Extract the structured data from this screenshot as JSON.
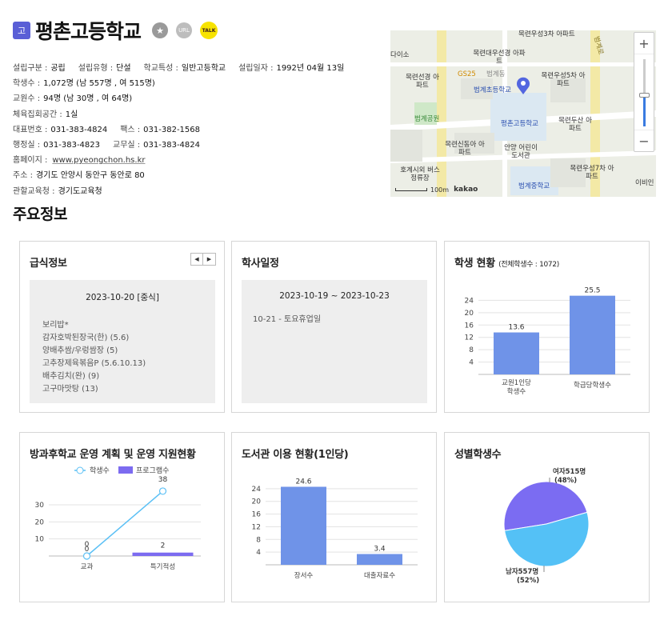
{
  "header": {
    "badge": "고",
    "name": "평촌고등학교",
    "url_label": "URL",
    "talk_label": "TALK"
  },
  "info": {
    "founding_type_label": "설립구분 :",
    "founding_type": "공립",
    "establish_type_label": "설립유형 :",
    "establish_type": "단설",
    "feature_label": "학교특성 :",
    "feature": "일반고등학교",
    "date_label": "설립일자 :",
    "date": "1992년 04월 13일",
    "students_label": "학생수 :",
    "students": "1,072명 (남 557명 , 여 515명)",
    "teachers_label": "교원수 :",
    "teachers": "94명 (남 30명 , 여 64명)",
    "gym_label": "체육집회공간 :",
    "gym": "1실",
    "phone_label": "대표번호 :",
    "phone": "031-383-4824",
    "fax_label": "팩스 :",
    "fax": "031-382-1568",
    "admin_label": "행정실 :",
    "admin": "031-383-4823",
    "staff_label": "교무실 :",
    "staff": "031-383-4824",
    "homepage_label": "홈페이지 :",
    "homepage": "www.pyeongchon.hs.kr",
    "address_label": "주소 :",
    "address": "경기도 안양시 동안구 동안로 80",
    "office_label": "관할교육청 :",
    "office": "경기도교육청"
  },
  "map": {
    "labels": [
      "목련대우선경 아파트",
      "목련선경 아파트",
      "GS25",
      "범계초등학교",
      "목련우성5차 아파트",
      "범계공원",
      "평촌고등학교",
      "목련두산 아파트",
      "목련신동아 아파트",
      "안양 어린이 도서관",
      "목련우성7차 아파트",
      "호계시외 버스정류장",
      "범계중학교",
      "다이소",
      "범계동",
      "이비인",
      "목련우성3차 아파트",
      "범계로"
    ],
    "scale": "100m",
    "brand": "kakao"
  },
  "section_title": "주요정보",
  "meal": {
    "title": "급식정보",
    "prev": "◀",
    "next": "▶",
    "date": "2023-10-20 [중식]",
    "items": [
      "보리밥*",
      "감자호박된장국(한) (5.6)",
      "양배추쌈/우렁쌈장 (5)",
      "고추장제육볶음P (5.6.10.13)",
      "배추김치(완) (9)",
      "고구마맛탕 (13)"
    ]
  },
  "schedule": {
    "title": "학사일정",
    "range": "2023-10-19 ~ 2023-10-23",
    "items": [
      "10-21 - 토요휴업일"
    ]
  },
  "student_status": {
    "title": "학생 현황",
    "subtitle": "(전체학생수 : 1072)"
  },
  "after_school": {
    "title": "방과후학교 운영 계획 및 운영 지원현황"
  },
  "library": {
    "title": "도서관 이용 현황(1인당)"
  },
  "gender": {
    "title": "성별학생수"
  },
  "colors": {
    "bar": "#6f93e8",
    "line": "#5bc0f5",
    "program": "#7c6bf0",
    "female": "#7b6cf2",
    "male": "#54c1f6",
    "badge": "#5a5fd6"
  },
  "chart_data": [
    {
      "type": "bar",
      "categories": [
        "교원1인당 학생수",
        "학급당학생수"
      ],
      "values": [
        13.6,
        25.5
      ],
      "ylim": [
        0,
        28
      ],
      "yticks": [
        4,
        8,
        12,
        16,
        20,
        24
      ]
    },
    {
      "type": "line",
      "categories": [
        "교과",
        "특기적성"
      ],
      "series": [
        {
          "name": "학생수",
          "kind": "line",
          "values": [
            0,
            38
          ]
        },
        {
          "name": "프로그램수",
          "kind": "bar",
          "values": [
            0,
            2
          ]
        }
      ],
      "ylim": [
        0,
        45
      ],
      "yticks": [
        10,
        20,
        30
      ]
    },
    {
      "type": "bar",
      "categories": [
        "장서수",
        "대출자료수"
      ],
      "values": [
        24.6,
        3.4
      ],
      "ylim": [
        0,
        28
      ],
      "yticks": [
        4,
        8,
        12,
        16,
        20,
        24
      ]
    },
    {
      "type": "pie",
      "labels": [
        "여자515명",
        "남자557명"
      ],
      "values": [
        515,
        557
      ],
      "percents": [
        "(48%)",
        "(52%)"
      ]
    }
  ]
}
